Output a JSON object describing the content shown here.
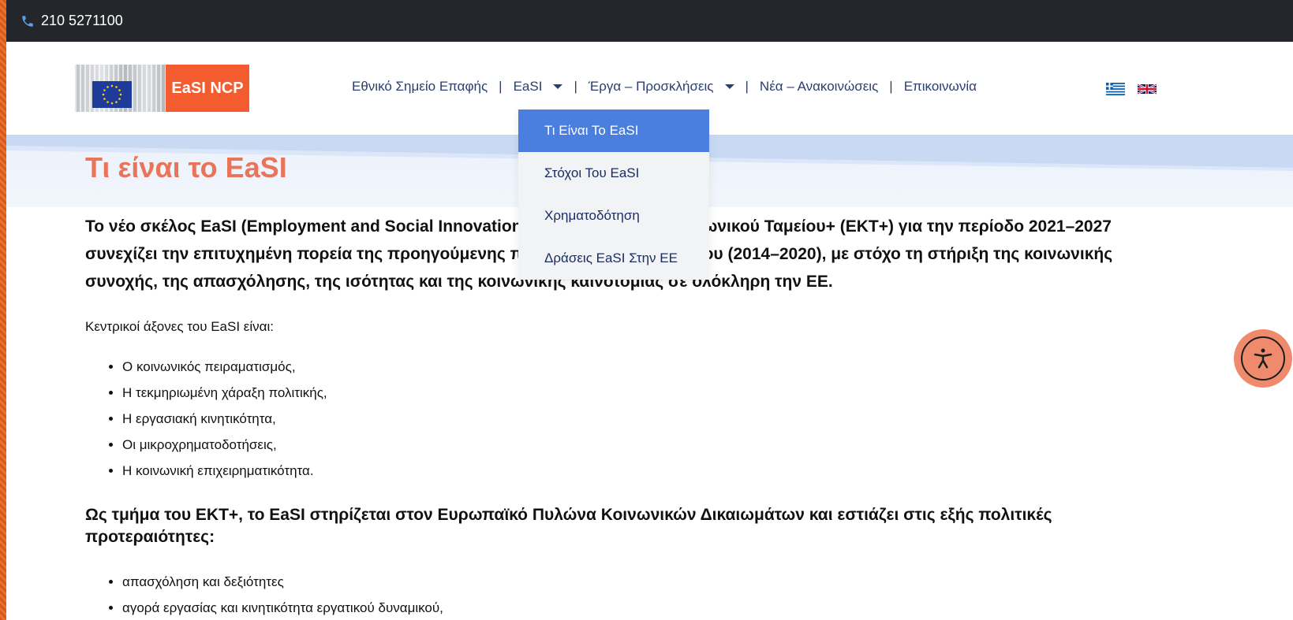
{
  "topbar": {
    "phone": "210 5271100",
    "icon": "phone-icon"
  },
  "logo": {
    "text": "EaSI NCP"
  },
  "nav": {
    "items": [
      {
        "label": "Εθνικό Σημείο Επαφής",
        "has_dropdown": false
      },
      {
        "label": "EaSI",
        "has_dropdown": true
      },
      {
        "label": "Έργα – Προσκλήσεις",
        "has_dropdown": true
      },
      {
        "label": "Νέα – Ανακοινώσεις",
        "has_dropdown": false
      },
      {
        "label": "Επικοινωνία",
        "has_dropdown": false
      }
    ],
    "separator": "|"
  },
  "dropdown": {
    "items": [
      {
        "label": "Τι Είναι Το EaSI",
        "active": true
      },
      {
        "label": "Στόχοι Του EaSI",
        "active": false
      },
      {
        "label": "Χρηματοδότηση",
        "active": false
      },
      {
        "label": "Δράσεις EaSI Στην ΕΕ",
        "active": false
      }
    ]
  },
  "languages": [
    {
      "name": "greek-flag-icon"
    },
    {
      "name": "uk-flag-icon"
    }
  ],
  "page": {
    "title": "Τι είναι το EaSI",
    "lead": "Το νέο σκέλος EaSI (Employment and Social Innovation) του Ευρωπαϊκού Κοινωνικού Ταμείου+ (ΕΚΤ+) για την περίοδο 2021–2027 συνεχίζει την επιτυχημένη πορεία της προηγούμενης προγραμματικής περιόδου (2014–2020), με στόχο τη στήριξη της κοινωνικής συνοχής, της απασχόλησης, της ισότητας και της κοινωνικής καινοτομίας σε ολόκληρη την ΕΕ.",
    "axes_intro": "Κεντρικοί άξονες του EaSI είναι:",
    "axes": [
      "Ο κοινωνικός πειραματισμός,",
      "Η τεκμηριωμένη χάραξη πολιτικής,",
      "Η εργασιακή κινητικότητα,",
      "Οι μικροχρηματοδοτήσεις,",
      "Η κοινωνική επιχειρηματικότητα."
    ],
    "priorities_intro": "Ως τμήμα του ΕΚΤ+, το EaSI στηρίζεται στον Ευρωπαϊκό Πυλώνα Κοινωνικών Δικαιωμάτων και εστιάζει στις εξής πολιτικές προτεραιότητες:",
    "priorities": [
      "απασχόληση και  δεξιότητες",
      "αγορά εργασίας και κινητικότητα εργατικού δυναμικού,"
    ]
  },
  "colors": {
    "accent": "#f25c2e",
    "title": "#e8745a",
    "nav_text": "#2a3f6b",
    "dropdown_active": "#4a7fe0"
  }
}
